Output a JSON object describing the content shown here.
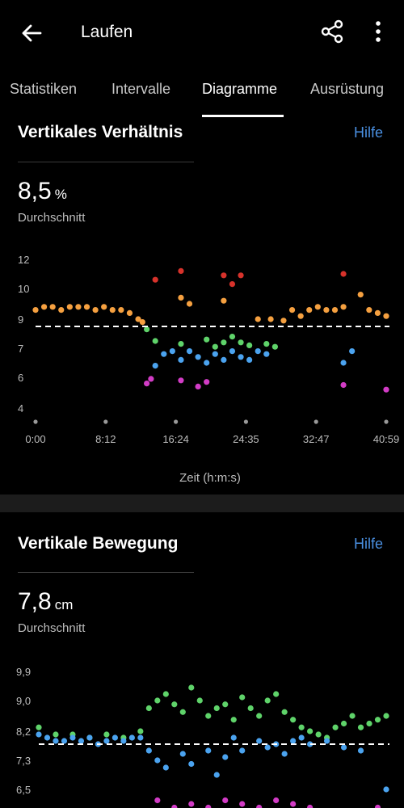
{
  "header": {
    "title": "Laufen",
    "back_icon": "arrow-left-icon",
    "share_icon": "share-icon",
    "more_icon": "more-vertical-icon"
  },
  "tabs": [
    {
      "label": "Statistiken"
    },
    {
      "label": "Intervalle"
    },
    {
      "label": "Diagramme",
      "active": true
    },
    {
      "label": "Ausrüstung"
    }
  ],
  "section1": {
    "title": "Vertikales Verhältnis",
    "help": "Hilfe",
    "value": "8,5",
    "unit": "%",
    "caption": "Durchschnitt"
  },
  "section2": {
    "title": "Vertikale Bewegung",
    "help": "Hilfe",
    "value": "7,8",
    "unit": "cm",
    "caption": "Durchschnitt"
  },
  "colors": {
    "orange": "#f5a040",
    "green": "#5fd36a",
    "blue": "#4ba3ef",
    "magenta": "#d23cc6",
    "red": "#d7322b",
    "accent": "#4a90e2"
  },
  "chart_data": [
    {
      "type": "scatter",
      "title": "Vertikales Verhältnis",
      "xlabel": "Zeit (h:m:s)",
      "ylabel": "",
      "x_ticks": [
        "0:00",
        "8:12",
        "16:24",
        "24:35",
        "32:47",
        "40:59"
      ],
      "y_ticks": [
        "4",
        "6",
        "7",
        "9",
        "10",
        "12"
      ],
      "x_range_min": [
        0,
        41
      ],
      "average": 8.5,
      "series": [
        {
          "color": "orange",
          "points": [
            [
              0,
              9.3
            ],
            [
              1,
              9.4
            ],
            [
              2,
              9.4
            ],
            [
              3,
              9.3
            ],
            [
              4,
              9.4
            ],
            [
              5,
              9.4
            ],
            [
              6,
              9.4
            ],
            [
              7,
              9.3
            ],
            [
              8,
              9.4
            ],
            [
              9,
              9.3
            ],
            [
              10,
              9.3
            ],
            [
              11,
              9.2
            ],
            [
              12,
              9.0
            ],
            [
              12.5,
              8.8
            ],
            [
              17,
              9.7
            ],
            [
              18,
              9.5
            ],
            [
              22,
              9.6
            ],
            [
              26,
              9.0
            ],
            [
              27.5,
              9.0
            ],
            [
              29,
              8.9
            ],
            [
              30,
              9.3
            ],
            [
              31,
              9.1
            ],
            [
              32,
              9.3
            ],
            [
              33,
              9.4
            ],
            [
              34,
              9.3
            ],
            [
              35,
              9.3
            ],
            [
              36,
              9.4
            ],
            [
              38,
              9.8
            ],
            [
              39,
              9.3
            ],
            [
              40,
              9.2
            ],
            [
              41,
              9.1
            ]
          ]
        },
        {
          "color": "green",
          "points": [
            [
              13,
              8.3
            ],
            [
              14,
              7.5
            ],
            [
              17,
              7.3
            ],
            [
              20,
              7.6
            ],
            [
              21,
              7.1
            ],
            [
              22,
              7.4
            ],
            [
              23,
              7.8
            ],
            [
              24,
              7.4
            ],
            [
              25,
              7.2
            ],
            [
              27,
              7.3
            ],
            [
              28,
              7.1
            ]
          ]
        },
        {
          "color": "blue",
          "points": [
            [
              14,
              6.4
            ],
            [
              15,
              6.8
            ],
            [
              16,
              6.9
            ],
            [
              17,
              6.6
            ],
            [
              18,
              6.9
            ],
            [
              19,
              6.7
            ],
            [
              20,
              6.5
            ],
            [
              21,
              6.8
            ],
            [
              22,
              6.6
            ],
            [
              23,
              6.9
            ],
            [
              24,
              6.7
            ],
            [
              25,
              6.6
            ],
            [
              26,
              6.9
            ],
            [
              27,
              6.8
            ],
            [
              36,
              6.5
            ],
            [
              37,
              6.9
            ]
          ]
        },
        {
          "color": "magenta",
          "points": [
            [
              13,
              5.6
            ],
            [
              13.5,
              5.9
            ],
            [
              17,
              5.8
            ],
            [
              19,
              5.4
            ],
            [
              20,
              5.7
            ],
            [
              36,
              5.5
            ],
            [
              41,
              5.2
            ]
          ]
        },
        {
          "color": "red",
          "points": [
            [
              14,
              10.6
            ],
            [
              17,
              11.2
            ],
            [
              22,
              10.9
            ],
            [
              23,
              10.3
            ],
            [
              24,
              10.9
            ],
            [
              36,
              11.0
            ]
          ]
        }
      ]
    },
    {
      "type": "scatter",
      "title": "Vertikale Bewegung",
      "xlabel": "",
      "ylabel": "",
      "y_ticks": [
        "9,9",
        "9,0",
        "8,2",
        "7,3",
        "6,5"
      ],
      "x_range_min": [
        0,
        41
      ],
      "average": 7.8,
      "series": [
        {
          "color": "green",
          "points": [
            [
              0,
              8.3
            ],
            [
              2,
              8.1
            ],
            [
              4,
              8.1
            ],
            [
              6,
              8.0
            ],
            [
              8,
              8.1
            ],
            [
              10,
              8.0
            ],
            [
              12,
              8.2
            ],
            [
              13,
              8.8
            ],
            [
              14,
              9.0
            ],
            [
              15,
              9.2
            ],
            [
              16,
              8.9
            ],
            [
              17,
              8.7
            ],
            [
              18,
              9.4
            ],
            [
              19,
              9.0
            ],
            [
              20,
              8.6
            ],
            [
              21,
              8.8
            ],
            [
              22,
              8.9
            ],
            [
              23,
              8.5
            ],
            [
              24,
              9.1
            ],
            [
              25,
              8.8
            ],
            [
              26,
              8.6
            ],
            [
              27,
              9.0
            ],
            [
              28,
              9.2
            ],
            [
              29,
              8.7
            ],
            [
              30,
              8.5
            ],
            [
              31,
              8.3
            ],
            [
              32,
              8.2
            ],
            [
              33,
              8.1
            ],
            [
              34,
              8.0
            ],
            [
              35,
              8.3
            ],
            [
              36,
              8.4
            ],
            [
              37,
              8.6
            ],
            [
              38,
              8.3
            ],
            [
              39,
              8.4
            ],
            [
              40,
              8.5
            ],
            [
              41,
              8.6
            ]
          ]
        },
        {
          "color": "blue",
          "points": [
            [
              0,
              8.1
            ],
            [
              1,
              8.0
            ],
            [
              2,
              7.9
            ],
            [
              3,
              7.9
            ],
            [
              4,
              8.0
            ],
            [
              5,
              7.9
            ],
            [
              6,
              8.0
            ],
            [
              7,
              7.8
            ],
            [
              8,
              7.9
            ],
            [
              9,
              8.0
            ],
            [
              10,
              7.9
            ],
            [
              11,
              8.0
            ],
            [
              12,
              8.0
            ],
            [
              13,
              7.6
            ],
            [
              14,
              7.3
            ],
            [
              15,
              7.1
            ],
            [
              17,
              7.5
            ],
            [
              18,
              7.2
            ],
            [
              20,
              7.6
            ],
            [
              21,
              6.9
            ],
            [
              22,
              7.4
            ],
            [
              23,
              8.0
            ],
            [
              24,
              7.6
            ],
            [
              26,
              7.9
            ],
            [
              27,
              7.7
            ],
            [
              28,
              7.8
            ],
            [
              29,
              7.5
            ],
            [
              30,
              7.9
            ],
            [
              31,
              8.0
            ],
            [
              32,
              7.8
            ],
            [
              34,
              7.9
            ],
            [
              36,
              7.7
            ],
            [
              38,
              7.6
            ],
            [
              41,
              6.5
            ]
          ]
        },
        {
          "color": "magenta",
          "points": [
            [
              14,
              6.2
            ],
            [
              16,
              6.0
            ],
            [
              18,
              6.1
            ],
            [
              20,
              6.0
            ],
            [
              22,
              6.2
            ],
            [
              24,
              6.1
            ],
            [
              26,
              6.0
            ],
            [
              28,
              6.2
            ],
            [
              30,
              6.1
            ],
            [
              32,
              6.0
            ],
            [
              40,
              6.0
            ]
          ]
        }
      ]
    }
  ]
}
